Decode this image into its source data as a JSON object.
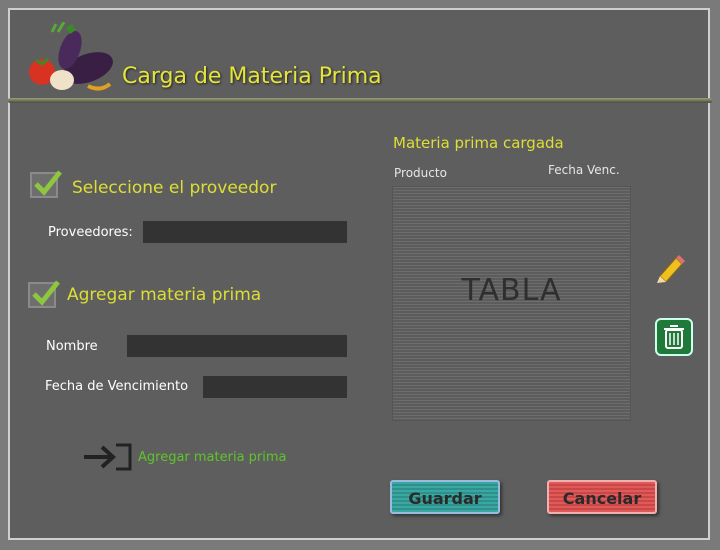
{
  "header": {
    "title": "Carga de Materia Prima"
  },
  "proveedor": {
    "section_title": "Seleccione el proveedor",
    "label": "Proveedores:",
    "value": ""
  },
  "materia": {
    "section_title": "Agregar materia prima",
    "nombre_label": "Nombre",
    "nombre_value": "",
    "fecha_label": "Fecha de Vencimiento",
    "fecha_value": "",
    "add_label": "Agregar materia prima"
  },
  "table": {
    "title": "Materia prima cargada",
    "columns": [
      "Producto",
      "Fecha Venc."
    ],
    "placeholder": "TABLA"
  },
  "buttons": {
    "save": "Guardar",
    "cancel": "Cancelar"
  },
  "icons": {
    "logo": "vegetables-logo-icon",
    "edit": "pencil-icon",
    "delete": "trash-icon",
    "add": "arrow-into-box-icon",
    "check": "checkmark-icon"
  },
  "colors": {
    "accent_yellow": "#dede34",
    "link_green": "#5fc42c",
    "save": "#3aa8a2",
    "cancel": "#e05a5a"
  }
}
